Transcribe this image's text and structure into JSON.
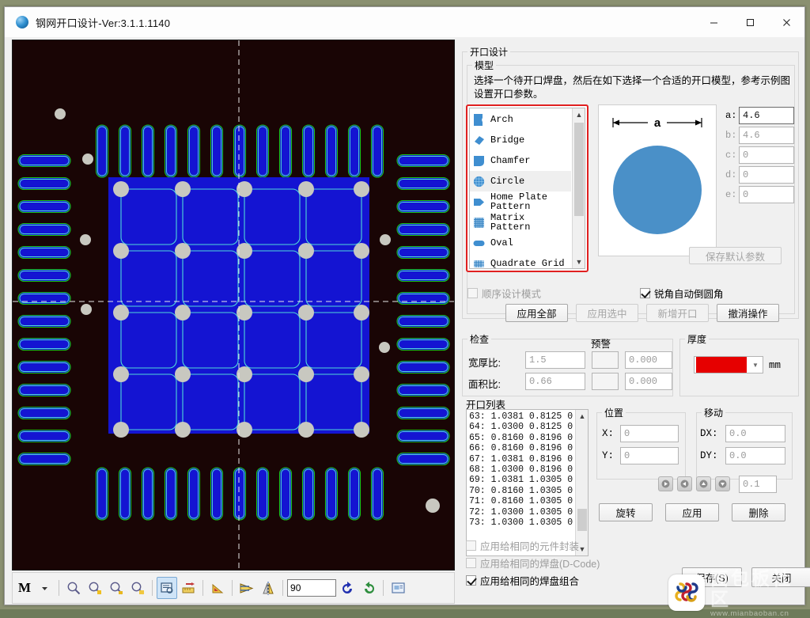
{
  "window": {
    "title": "钢网开口设计-Ver:3.1.1.1140",
    "icon": "globe-icon",
    "minimize": "−",
    "maximize": "□",
    "close": "✕"
  },
  "opening_design": {
    "legend": "开口设计",
    "model_legend": "模型",
    "description": "选择一个待开口焊盘，然后在如下选择一个合适的开口模型，参考示例图设置开口参数。",
    "model_list": [
      {
        "label": "Arch",
        "icon": "arch-shape-icon",
        "selected": false
      },
      {
        "label": "Bridge",
        "icon": "bridge-shape-icon",
        "selected": false
      },
      {
        "label": "Chamfer",
        "icon": "chamfer-shape-icon",
        "selected": false
      },
      {
        "label": "Circle",
        "icon": "circle-shape-icon",
        "selected": true
      },
      {
        "label": "Home Plate\nPattern",
        "icon": "home-plate-shape-icon",
        "selected": false
      },
      {
        "label": "Matrix Pattern",
        "icon": "matrix-shape-icon",
        "selected": false
      },
      {
        "label": "Oval",
        "icon": "oval-shape-icon",
        "selected": false
      },
      {
        "label": "Quadrate Grid",
        "icon": "quadrate-grid-shape-icon",
        "selected": false
      }
    ],
    "preview": {
      "dimension_label": "a",
      "shape": "circle",
      "shape_color": "#4a90c8"
    },
    "params": [
      {
        "label": "a:",
        "value": "4.6",
        "disabled": false
      },
      {
        "label": "b:",
        "value": "4.6",
        "disabled": true
      },
      {
        "label": "c:",
        "value": "0",
        "disabled": true
      },
      {
        "label": "d:",
        "value": "0",
        "disabled": true
      },
      {
        "label": "e:",
        "value": "0",
        "disabled": true
      }
    ],
    "save_default_button": "保存默认参数",
    "sequential_mode": {
      "label": "顺序设计模式",
      "checked": false,
      "disabled": true
    },
    "auto_fillet": {
      "label": "锐角自动倒圆角",
      "checked": true,
      "disabled": false
    },
    "actions": [
      {
        "label": "应用全部",
        "disabled": false
      },
      {
        "label": "应用选中",
        "disabled": true
      },
      {
        "label": "新增开口",
        "disabled": true
      },
      {
        "label": "撤消操作",
        "disabled": false
      }
    ]
  },
  "check": {
    "legend": "检查",
    "warn_header": "预警",
    "rows": [
      {
        "label": "宽厚比:",
        "value": "1.5",
        "warn": "0.000"
      },
      {
        "label": "面积比:",
        "value": "0.66",
        "warn": "0.000"
      }
    ]
  },
  "thickness": {
    "legend": "厚度",
    "selected_color": "#e60000",
    "unit": "mm"
  },
  "opening_list": {
    "legend": "开口列表",
    "rows": [
      "63: 1.0381 0.8125 0",
      "64: 1.0300 0.8125 0",
      "65: 0.8160 0.8196 0",
      "66: 0.8160 0.8196 0",
      "67: 1.0381 0.8196 0",
      "68: 1.0300 0.8196 0",
      "69: 1.0381 1.0305 0",
      "70: 0.8160 1.0305 0",
      "71: 0.8160 1.0305 0",
      "72: 1.0300 1.0305 0",
      "73: 1.0300 1.0305 0"
    ]
  },
  "position": {
    "legend": "位置",
    "x": {
      "label": "X:",
      "value": "0"
    },
    "y": {
      "label": "Y:",
      "value": "0"
    }
  },
  "move": {
    "legend": "移动",
    "dx": {
      "label": "DX:",
      "value": "0.0"
    },
    "dy": {
      "label": "DY:",
      "value": "0.0"
    },
    "step": "0.1",
    "nudges": [
      "nudge-right-icon",
      "nudge-left-icon",
      "nudge-up-icon",
      "nudge-down-icon"
    ]
  },
  "row_buttons": [
    {
      "label": "旋转"
    },
    {
      "label": "应用"
    },
    {
      "label": "删除"
    }
  ],
  "apply_options": [
    {
      "label": "应用给相同的元件封装",
      "checked": false,
      "disabled": true
    },
    {
      "label": "应用给相同的焊盘(D-Code)",
      "checked": false,
      "disabled": true
    },
    {
      "label": "应用给相同的焊盘组合",
      "checked": true,
      "disabled": false
    }
  ],
  "footer_buttons": [
    {
      "label": "保存(S)"
    },
    {
      "label": "关闭"
    }
  ],
  "toolbar": {
    "mode_label": "M",
    "rotation_value": "90",
    "items": [
      "mode-dropdown-icon",
      "zoom-icon",
      "zoom-in-icon",
      "zoom-out-icon",
      "zoom-fit-icon",
      "view-selection-icon",
      "measure-icon",
      "angle-icon",
      "flip-horizontal-icon",
      "flip-vertical-icon",
      "rotate-ccw-icon",
      "rotate-cw-icon",
      "image-properties-icon"
    ]
  },
  "watermark": {
    "cn": "面包板社区",
    "en": "www.mianbaoban.cn"
  },
  "canvas": {
    "name": "pcb-stencil-canvas",
    "background": "#000000",
    "pad_fill": "#1414d2",
    "pad_outline": "#18c818",
    "opening_outline": "#4fd8d8",
    "via_fill": "#c8c8c0",
    "crosshair_color": "#e8e8e8",
    "center_block_fill": "#1414d2"
  }
}
